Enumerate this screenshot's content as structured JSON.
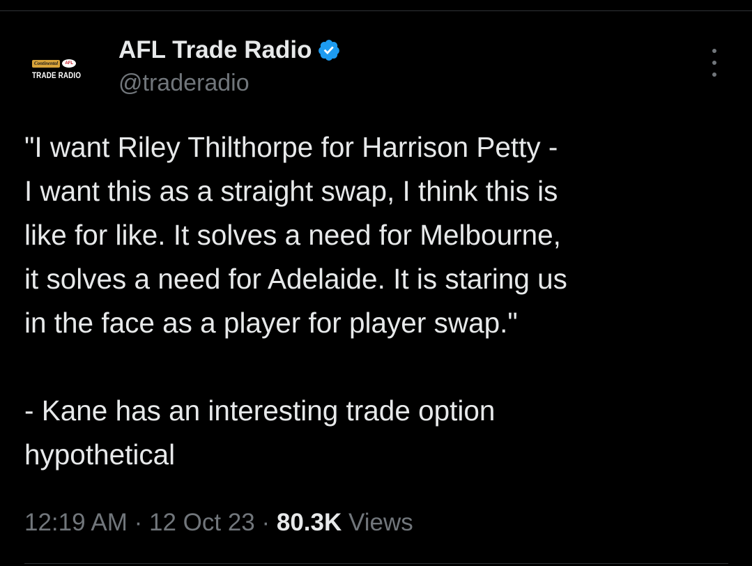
{
  "author": {
    "display_name": "AFL Trade Radio",
    "handle": "@traderadio",
    "verified_icon": "verified-badge-icon",
    "avatar": {
      "brand_top": "Continental",
      "brand_afl": "AFL",
      "brand_name": "TRADE RADIO"
    }
  },
  "tweet": {
    "text": "\"I want Riley Thilthorpe for Harrison Petty -\nI want this as a straight swap, I think this is\nlike for like. It solves a need for Melbourne,\nit solves a need for Adelaide. It is staring us\nin the face as a player for player swap.\"\n\n- Kane has an interesting trade option\nhypothetical"
  },
  "meta": {
    "time": "12:19 AM",
    "separator1": " · ",
    "date": "12 Oct 23",
    "separator2": " · ",
    "views_count": "80.3K",
    "views_label": " Views"
  },
  "colors": {
    "background": "#000000",
    "text": "#e7e9ea",
    "secondary": "#71767b",
    "verified": "#1d9bf0"
  }
}
